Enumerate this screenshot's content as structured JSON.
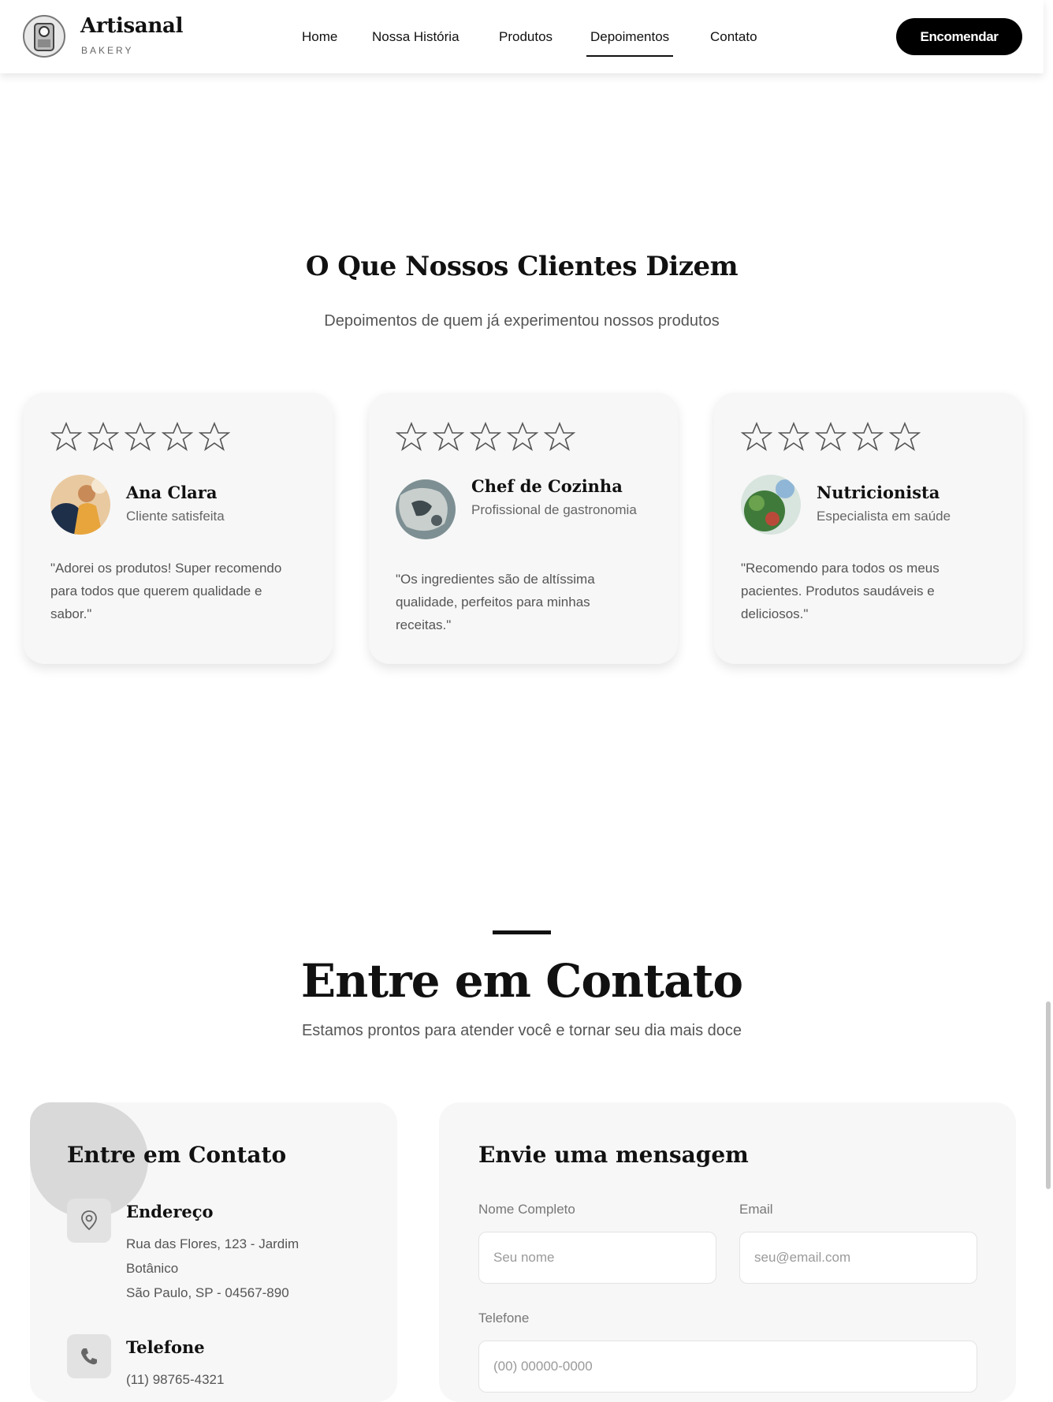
{
  "header": {
    "brand_name": "Artisanal",
    "brand_tag": "BAKERY",
    "nav": [
      "Home",
      "Nossa História",
      "Produtos",
      "Depoimentos",
      "Contato"
    ],
    "active_nav": "Depoimentos",
    "cta_label": "Encomendar"
  },
  "testimonials": {
    "title": "O Que Nossos Clientes Dizem",
    "subtitle": "Depoimentos de quem já experimentou nossos produtos",
    "cards": [
      {
        "name": "Ana Clara",
        "role": "Cliente satisfeita",
        "rating": 5,
        "quote": "\"Adorei os produtos! Super recomendo para todos que querem qualidade e sabor.\""
      },
      {
        "name": "Chef de Cozinha",
        "role": "Profissional de gastronomia",
        "rating": 5,
        "quote": "\"Os ingredientes são de altíssima qualidade, perfeitos para minhas receitas.\""
      },
      {
        "name": "Nutricionista",
        "role": "Especialista em saúde",
        "rating": 5,
        "quote": "\"Recomendo para todos os meus pacientes. Produtos saudáveis e deliciosos.\""
      }
    ]
  },
  "contact": {
    "title": "Entre em Contato",
    "subtitle": "Estamos prontos para atender você e tornar seu dia mais doce",
    "info": {
      "title": "Entre em Contato",
      "address_label": "Endereço",
      "address_line1": "Rua das Flores, 123 - Jardim Botânico",
      "address_line2": "São Paulo, SP - 04567-890",
      "phone_label": "Telefone",
      "phone": "(11) 98765-4321"
    },
    "form": {
      "title": "Envie uma mensagem",
      "name_label": "Nome Completo",
      "name_placeholder": "Seu nome",
      "email_label": "Email",
      "email_placeholder": "seu@email.com",
      "phone_label": "Telefone",
      "phone_placeholder": "(00) 00000-0000"
    }
  }
}
